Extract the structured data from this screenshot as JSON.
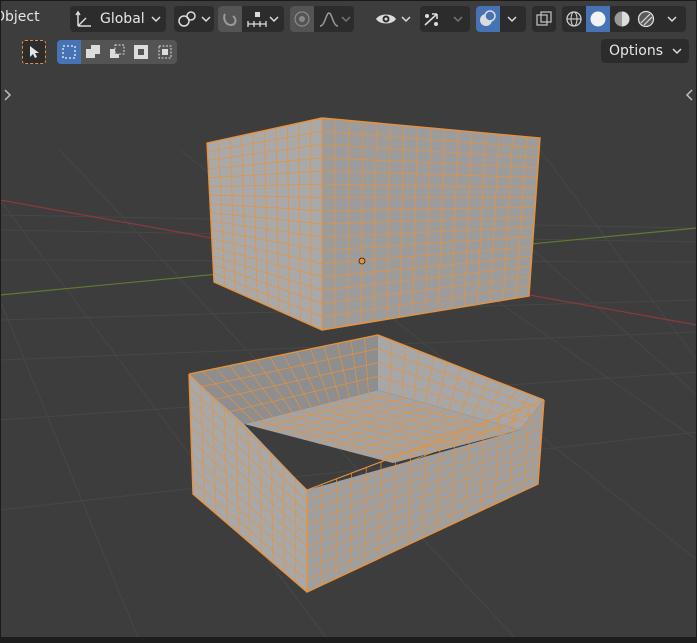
{
  "header": {
    "mode_label": "Object",
    "transform_orientation": "Global",
    "options_label": "Options"
  },
  "icons": {
    "cursor": "select-cursor-icon",
    "transform": "transform-orientation-icon",
    "pivot": "pivot-link-icon",
    "snap": "magnet-snap-icon",
    "snap_target": "snap-increment-icon",
    "proportional": "proportional-edit-icon",
    "falloff": "falloff-curve-icon",
    "visibility": "visibility-eye-icon",
    "gizmo": "gizmo-icon",
    "overlay": "overlay-icon",
    "xray": "xray-icon",
    "shading_wire": "wireframe-shading-icon",
    "shading_solid": "solid-shading-icon",
    "shading_material": "material-shading-icon",
    "shading_rendered": "rendered-shading-icon"
  },
  "colors": {
    "viewport_bg": "#3d3d3d",
    "grid": "#474747",
    "x_axis": "#8a3a3e",
    "y_axis": "#5e7a30",
    "selection": "#e8913a",
    "face_light": "#a8a8a8",
    "face_mid": "#9e9e9e",
    "face_dark": "#8f8f8f",
    "accent": "#4772b3"
  },
  "selection_mode_active": "new"
}
